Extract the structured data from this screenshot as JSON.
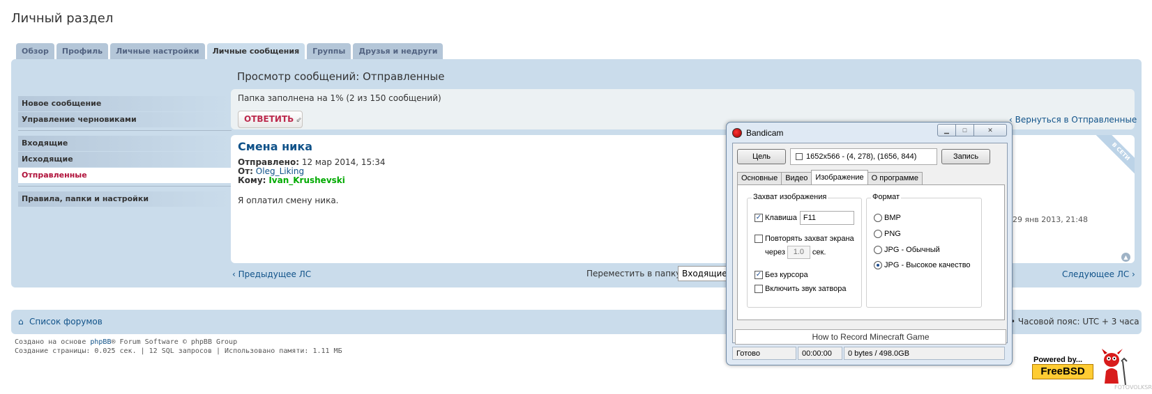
{
  "page": {
    "title": "Личный раздел"
  },
  "tabs": [
    {
      "label": "Обзор",
      "active": false
    },
    {
      "label": "Профиль",
      "active": false
    },
    {
      "label": "Личные настройки",
      "active": false
    },
    {
      "label": "Личные сообщения",
      "active": true
    },
    {
      "label": "Группы",
      "active": false
    },
    {
      "label": "Друзья и недруги",
      "active": false
    }
  ],
  "sidebar": {
    "group1": [
      "Новое сообщение",
      "Управление черновиками"
    ],
    "group2": [
      {
        "label": "Входящие",
        "active": false
      },
      {
        "label": "Исходящие",
        "active": false
      },
      {
        "label": "Отправленные",
        "active": true
      }
    ],
    "group3": [
      "Правила, папки и настройки"
    ]
  },
  "main": {
    "header": "Просмотр сообщений: Отправленные",
    "folder_fill": "Папка заполнена на 1% (2 из 150 сообщений)",
    "reply_label": "ОТВЕТИТЬ",
    "back_link": "Вернуться в Отправленные",
    "message": {
      "subject": "Смена ника",
      "sent_label": "Отправлено:",
      "sent_value": "12 мар 2014, 15:34",
      "from_label": "От:",
      "from_value": "Oleg_Liking",
      "to_label": "Кому:",
      "to_value": "Ivan_Krushevski",
      "body": "Я оплатил смену ника.",
      "online_badge": "В СЕТИ",
      "date_right": "29 янв 2013, 21:48"
    },
    "prev_link": "Предыдущее ЛС",
    "move_label": "Переместить в папку:",
    "move_value": "Входящие",
    "next_link": "Следующее ЛС"
  },
  "footer": {
    "forum_list": "Список форумов",
    "timezone": "Часовой пояс: UTC + 3 часа",
    "credits_prefix": "Создано на основе ",
    "credits_link": "phpBB",
    "credits_suffix": "® Forum Software © phpBB Group",
    "stats": "Создание страницы: 0.025 сек. | 12 SQL запросов | Использовано памяти: 1.11 МБ"
  },
  "bandicam": {
    "title": "Bandicam",
    "target_btn": "Цель",
    "area": "1652x566 - (4, 278), (1656, 844)",
    "record_btn": "Запись",
    "tabs": [
      {
        "label": "Основные",
        "active": false
      },
      {
        "label": "Видео",
        "active": false
      },
      {
        "label": "Изображение",
        "active": true
      },
      {
        "label": "О программе",
        "active": false
      }
    ],
    "capture_group": "Захват изображения",
    "hotkey_label": "Клавиша",
    "hotkey_checked": true,
    "hotkey_value": "F11",
    "repeat_label": "Повторять захват экрана",
    "repeat_checked": false,
    "every_label": "через",
    "every_value": "1.0",
    "every_unit": "сек.",
    "no_cursor_label": "Без курсора",
    "no_cursor_checked": true,
    "shutter_label": "Включить звук затвора",
    "shutter_checked": false,
    "format_group": "Формат",
    "formats": [
      {
        "label": "BMP",
        "selected": false
      },
      {
        "label": "PNG",
        "selected": false
      },
      {
        "label": "JPG - Обычный",
        "selected": false
      },
      {
        "label": "JPG - Высокое качество",
        "selected": true
      }
    ],
    "howto": "How to Record Minecraft Game",
    "status": {
      "state": "Готово",
      "time": "00:00:00",
      "size": "0 bytes / 498.0GB"
    }
  },
  "badge": {
    "powered": "Powered by...",
    "brand": "FreeBSD"
  },
  "watermark": "FOTOVOLKSRU"
}
